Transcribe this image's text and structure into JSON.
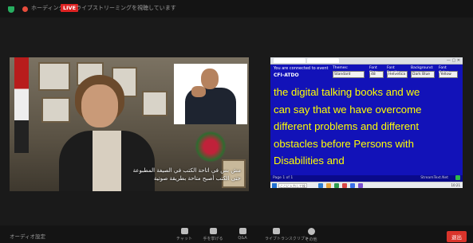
{
  "topbar": {
    "host_label": "ホーディング",
    "live_badge": "LIVE",
    "viewing_label": "ライブストリーミングを視聴しています"
  },
  "left_video": {
    "subtitle_line1": "مش بس في اتاحة الكتب في الصيغة المطبوعة",
    "subtitle_line2": "حتى الكتب أصبح متاحة بطريقة صوتية"
  },
  "captions": {
    "connected_text": "You are connected to event",
    "event_name": "CFI-ATDO",
    "controls": [
      {
        "label": "Themes:",
        "value": "Standard"
      },
      {
        "label": "Font Size:",
        "value": "48"
      },
      {
        "label": "Font Family:",
        "value": "Helvetica"
      },
      {
        "label": "Background:",
        "value": "Dark Blue"
      },
      {
        "label": "Font Color:",
        "value": "Yellow"
      }
    ],
    "lines": [
      "the digital talking books and we",
      "can say that we have overcome",
      "different problems and different",
      "obstacles before Persons with",
      "Disabilities and"
    ],
    "page_text": "Page 1 of 1",
    "status_text": "StreamText.Net",
    "text_color": "#ffff00",
    "background_color": "#1212b8"
  },
  "taskbar": {
    "search_placeholder": "ここに入力して検索",
    "clock": "10:21"
  },
  "bottombar": {
    "audio_settings": "オーディオ設定",
    "tools": [
      {
        "label": "チャット",
        "icon": "chat-icon"
      },
      {
        "label": "手を挙げる",
        "icon": "raise-hand-icon"
      },
      {
        "label": "Q&A",
        "icon": "qa-icon"
      },
      {
        "label": "ライブトランスクリプト",
        "icon": "cc-icon"
      },
      {
        "label": "その他",
        "icon": "more-icon"
      }
    ],
    "leave_label": "退出"
  }
}
